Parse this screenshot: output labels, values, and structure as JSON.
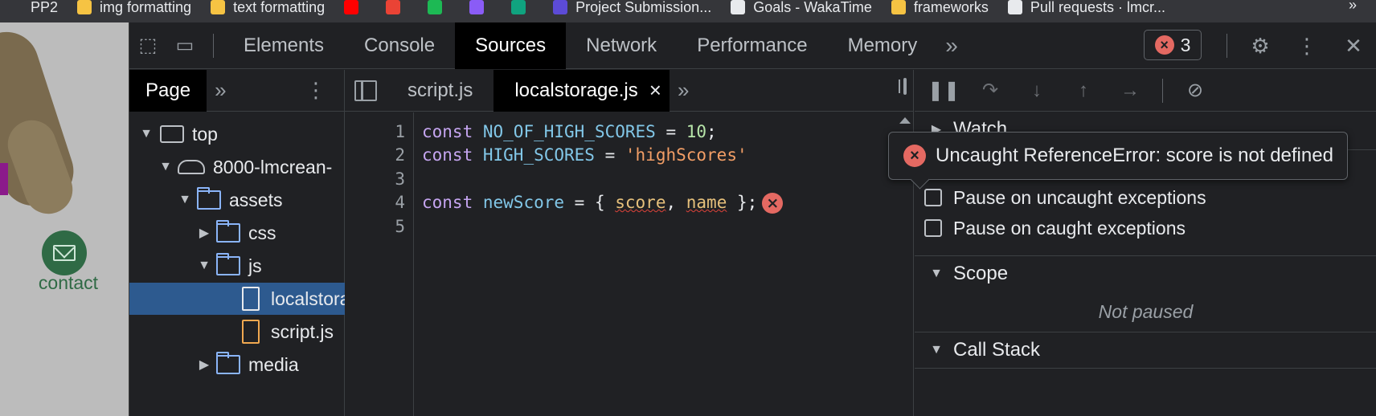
{
  "bookmarks": [
    {
      "label": "PP2",
      "color": "#35363a"
    },
    {
      "label": "img formatting",
      "color": "#f6c343"
    },
    {
      "label": "text formatting",
      "color": "#f6c343"
    },
    {
      "label": "",
      "color": "#ff0000"
    },
    {
      "label": "",
      "color": "#ea4335"
    },
    {
      "label": "",
      "color": "#1db954"
    },
    {
      "label": "",
      "color": "#8a5cf6"
    },
    {
      "label": "",
      "color": "#10a37f"
    },
    {
      "label": "Project Submission...",
      "color": "#5c4bd6"
    },
    {
      "label": "Goals - WakaTime",
      "color": "#e8eaed"
    },
    {
      "label": "frameworks",
      "color": "#f6c343"
    },
    {
      "label": "Pull requests · lmcr...",
      "color": "#e8eaed"
    }
  ],
  "bookmarks_more": "»",
  "page": {
    "contact_label": "contact"
  },
  "devtools": {
    "tabs": [
      "Elements",
      "Console",
      "Sources",
      "Network",
      "Performance",
      "Memory"
    ],
    "active_tab": "Sources",
    "more_tabs": "»",
    "error_count": "3",
    "navigator": {
      "tab": "Page",
      "more": "»",
      "tree": [
        {
          "label": "top",
          "kind": "frame",
          "depth": 0,
          "expanded": true
        },
        {
          "label": "8000-lmcrean-",
          "kind": "cloud",
          "depth": 1,
          "expanded": true
        },
        {
          "label": "assets",
          "kind": "folder",
          "depth": 2,
          "expanded": true
        },
        {
          "label": "css",
          "kind": "folder",
          "depth": 3,
          "expanded": false
        },
        {
          "label": "js",
          "kind": "folder",
          "depth": 3,
          "expanded": true
        },
        {
          "label": "localstorage.js",
          "kind": "file",
          "depth": 4,
          "selected": true
        },
        {
          "label": "script.js",
          "kind": "file-js",
          "depth": 4
        },
        {
          "label": "media",
          "kind": "folder",
          "depth": 3,
          "expanded": false
        }
      ]
    },
    "editor": {
      "tabs": [
        {
          "label": "script.js",
          "active": false
        },
        {
          "label": "localstorage.js",
          "active": true
        }
      ],
      "close_glyph": "×",
      "more": "»",
      "line_numbers": [
        "1",
        "2",
        "3",
        "4",
        "5"
      ],
      "code": {
        "l1": {
          "kw": "const",
          "name": "NO_OF_HIGH_SCORES",
          "op": " = ",
          "val": "10",
          "end": ";"
        },
        "l2": {
          "kw": "const",
          "name": "HIGH_SCORES",
          "op": " = ",
          "val": "'highScores'"
        },
        "l4": {
          "kw": "const",
          "name": "newScore",
          "op": " = { ",
          "p1": "score",
          "sep": ", ",
          "p2": "name",
          "end": " };"
        }
      },
      "inline_error_glyph": "×"
    },
    "tooltip": {
      "message": "Uncaught ReferenceError: score is not defined",
      "glyph": "×"
    },
    "debugger": {
      "sections": {
        "watch": "Watch",
        "pause_uncaught": "Pause on uncaught exceptions",
        "pause_caught": "Pause on caught exceptions",
        "scope": "Scope",
        "not_paused": "Not paused",
        "call_stack": "Call Stack"
      }
    }
  }
}
